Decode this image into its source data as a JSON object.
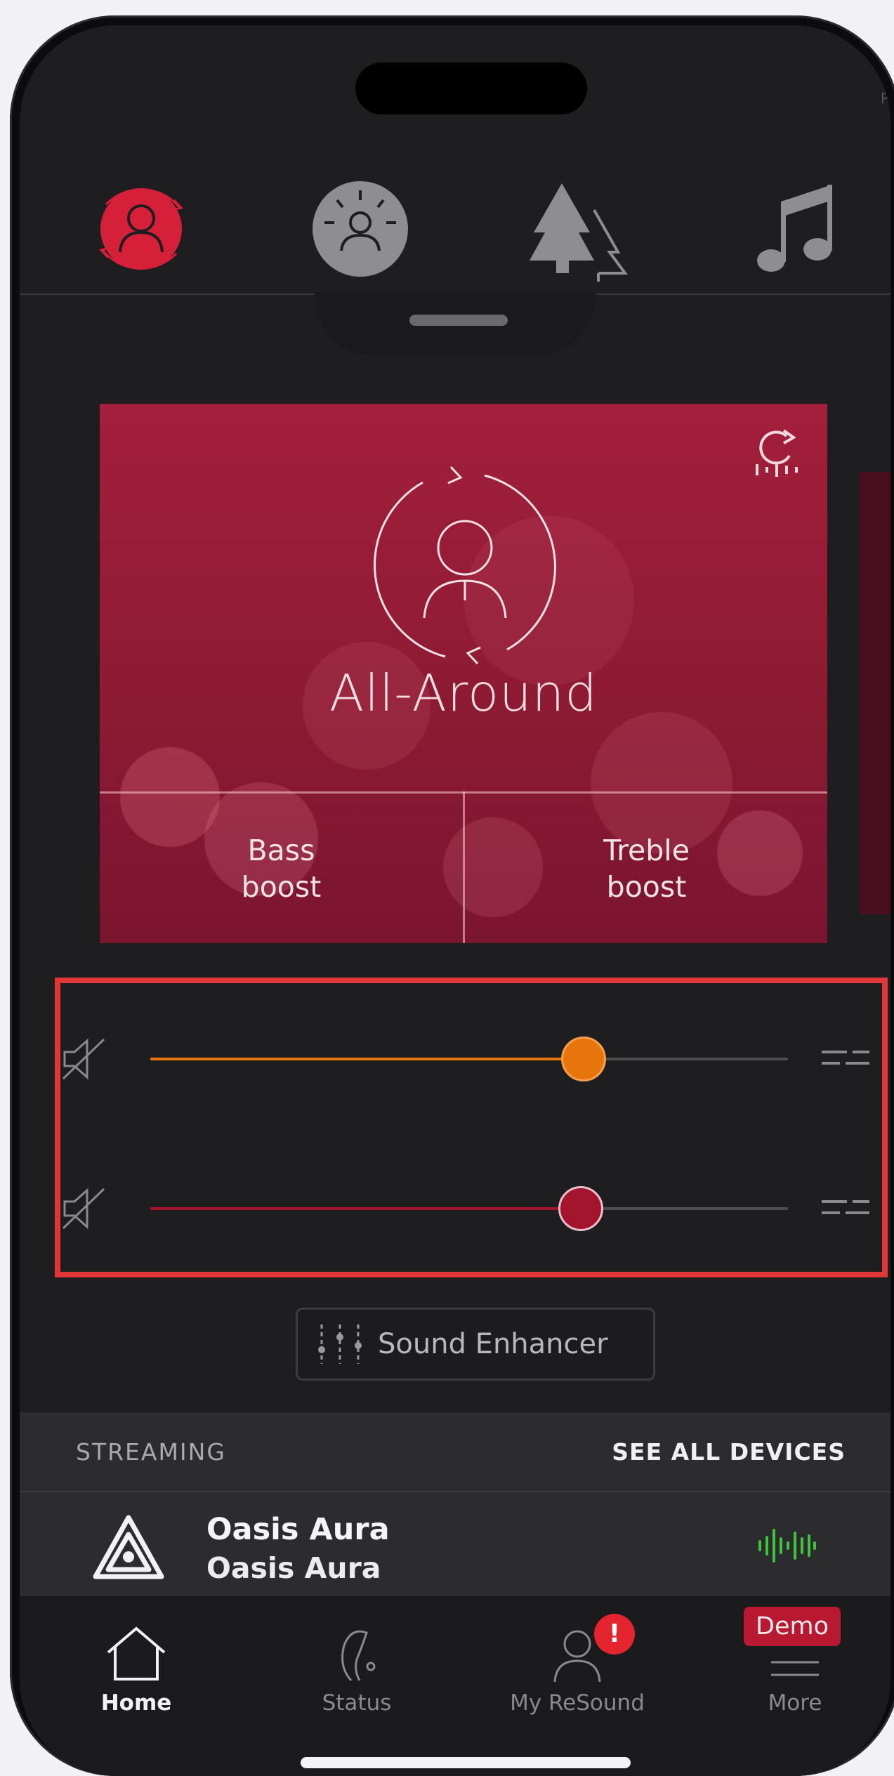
{
  "programs": {
    "items": [
      {
        "name": "all-around-program",
        "icon": "person-cycle-icon",
        "active": true
      },
      {
        "name": "restaurant-program",
        "icon": "person-surround-icon",
        "active": false
      },
      {
        "name": "outdoor-program",
        "icon": "trees-icon",
        "active": false
      },
      {
        "name": "music-program",
        "icon": "music-note-icon",
        "active": false
      }
    ]
  },
  "card": {
    "program_name": "All-Around",
    "bass_label": "Bass\nboost",
    "treble_label": "Treble\nboost",
    "colors": {
      "card": "#9b1c38"
    }
  },
  "sliders": [
    {
      "name": "volume-slider-1",
      "value_fraction": 0.68,
      "color": "#e8740c"
    },
    {
      "name": "volume-slider-2",
      "value_fraction": 0.675,
      "color": "#a4152d"
    }
  ],
  "enhancer": {
    "label": "Sound Enhancer"
  },
  "streaming": {
    "title": "STREAMING",
    "see_all": "SEE ALL DEVICES",
    "device": {
      "name": "Oasis Aura",
      "subtitle": "Oasis Aura",
      "wave_color": "#3ec43e"
    }
  },
  "tabs": [
    {
      "label": "Home",
      "icon": "home-icon",
      "active": true
    },
    {
      "label": "Status",
      "icon": "hearing-aid-icon",
      "active": false
    },
    {
      "label": "My ReSound",
      "icon": "user-icon",
      "active": false
    },
    {
      "label": "More",
      "icon": "menu-icon",
      "active": false
    }
  ],
  "badges": {
    "alert": "!",
    "demo": "Demo"
  },
  "edge_mark": "P"
}
